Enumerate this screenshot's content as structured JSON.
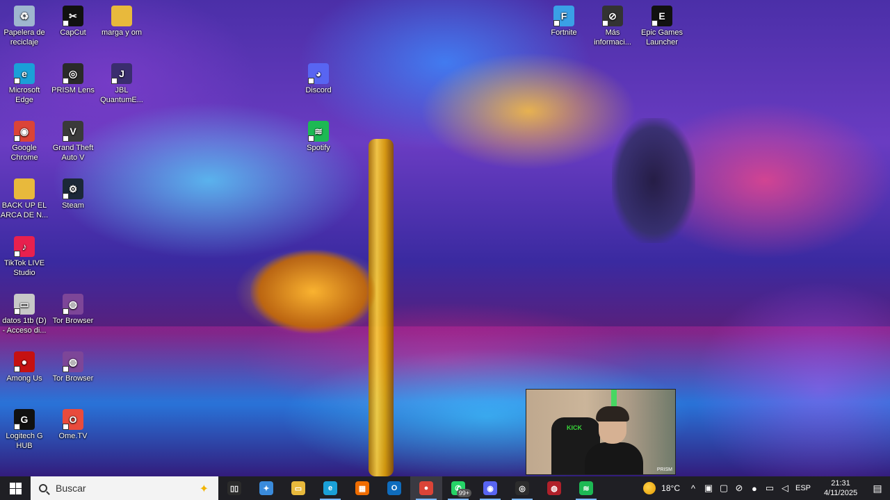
{
  "desktop": {
    "icons": [
      {
        "label": "Papelera de reciclaje",
        "icon": "recycle-bin-icon",
        "color": "#9fb6cf"
      },
      {
        "label": "CapCut",
        "icon": "capcut-icon",
        "color": "#111111"
      },
      {
        "label": "marga y om",
        "icon": "folder-icon",
        "color": "#e8b93c"
      },
      {
        "label": "Microsoft Edge",
        "icon": "edge-icon",
        "color": "#1aa0d8"
      },
      {
        "label": "PRISM Lens",
        "icon": "prism-lens-icon",
        "color": "#2a2a2a"
      },
      {
        "label": "JBL QuantumE...",
        "icon": "jbl-icon",
        "color": "#3a2d6e"
      },
      {
        "label": "Google Chrome",
        "icon": "chrome-icon",
        "color": "#db4437"
      },
      {
        "label": "Grand Theft Auto V",
        "icon": "gta-icon",
        "color": "#3a3a3a"
      },
      {
        "label": "BACK UP EL ARCA DE N...",
        "icon": "folder-icon",
        "color": "#e8b93c"
      },
      {
        "label": "Steam",
        "icon": "steam-icon",
        "color": "#1b2838"
      },
      {
        "label": "TikTok LIVE Studio",
        "icon": "tiktok-live-icon",
        "color": "#e8204e"
      },
      {
        "label": "datos 1tb (D) - Acceso di...",
        "icon": "drive-icon",
        "color": "#c8c8c8"
      },
      {
        "label": "Tor Browser",
        "icon": "tor-icon",
        "color": "#7d4698"
      },
      {
        "label": "Among Us",
        "icon": "among-us-icon",
        "color": "#c51111"
      },
      {
        "label": "Tor Browser",
        "icon": "tor-icon",
        "color": "#7d4698"
      },
      {
        "label": "Logitech G HUB",
        "icon": "logitech-icon",
        "color": "#111111"
      },
      {
        "label": "Ome.TV",
        "icon": "ometv-icon",
        "color": "#e94b3c"
      },
      {
        "label": "Discord",
        "icon": "discord-icon",
        "color": "#5865f2"
      },
      {
        "label": "Spotify",
        "icon": "spotify-icon",
        "color": "#1db954"
      },
      {
        "label": "Fortnite",
        "icon": "fortnite-icon",
        "color": "#3aa0e6"
      },
      {
        "label": "Más informaci...",
        "icon": "info-icon",
        "color": "#333333"
      },
      {
        "label": "Epic Games Launcher",
        "icon": "epic-icon",
        "color": "#111111"
      }
    ]
  },
  "webcam": {
    "chair_text": "KICK",
    "tag": "PRISM"
  },
  "taskbar": {
    "search_placeholder": "Buscar",
    "apps": [
      {
        "name": "task-view",
        "glyph": "▯▯",
        "color": "#2b2b2b"
      },
      {
        "name": "copilot",
        "glyph": "✦",
        "color": "#3a8bdc"
      },
      {
        "name": "file-explorer",
        "glyph": "▭",
        "color": "#e8b93c"
      },
      {
        "name": "edge",
        "glyph": "e",
        "color": "#1aa0d8"
      },
      {
        "name": "microsoft-store",
        "glyph": "▦",
        "color": "#ef6c00"
      },
      {
        "name": "outlook",
        "glyph": "O",
        "color": "#0f6cbd"
      },
      {
        "name": "chrome",
        "glyph": "●",
        "color": "#db4437"
      },
      {
        "name": "whatsapp",
        "glyph": "✆",
        "color": "#25d366",
        "badge": "99+"
      },
      {
        "name": "discord",
        "glyph": "◉",
        "color": "#5865f2"
      },
      {
        "name": "obs",
        "glyph": "◎",
        "color": "#2c2c2c"
      },
      {
        "name": "screen-recorder",
        "glyph": "◍",
        "color": "#b0202a"
      },
      {
        "name": "spotify",
        "glyph": "≋",
        "color": "#1db954"
      }
    ],
    "weather": "18°C",
    "language": "ESP",
    "time": "21:31",
    "date": "4/11/2025"
  }
}
